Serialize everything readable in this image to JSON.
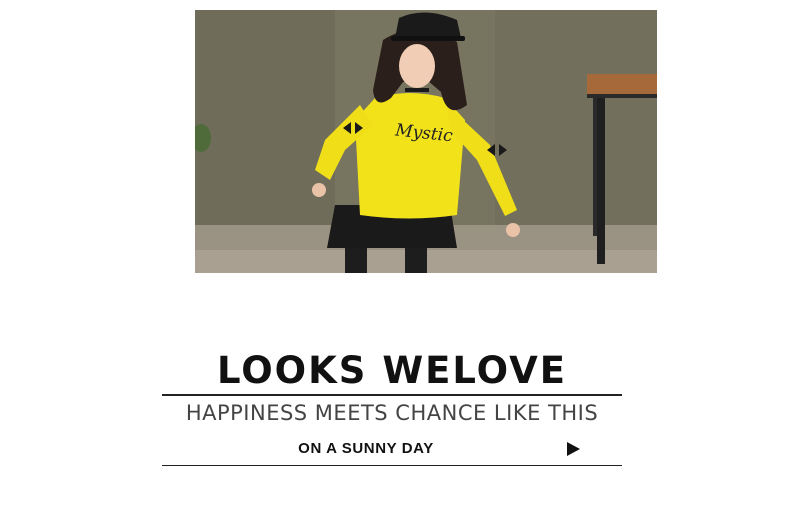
{
  "photo": {
    "shirt_print": "Mystic",
    "description_icon": "product-photo"
  },
  "headline": "LOOKS WELOVE",
  "subline": "HAPPINESS MEETS CHANCE LIKE THIS",
  "tagline": "ON A SUNNY DAY",
  "play_icon": "play-icon",
  "colors": {
    "text_dark": "#111111",
    "text_gray": "#444444",
    "rule": "#222222",
    "shirt_yellow": "#f2e21a"
  }
}
